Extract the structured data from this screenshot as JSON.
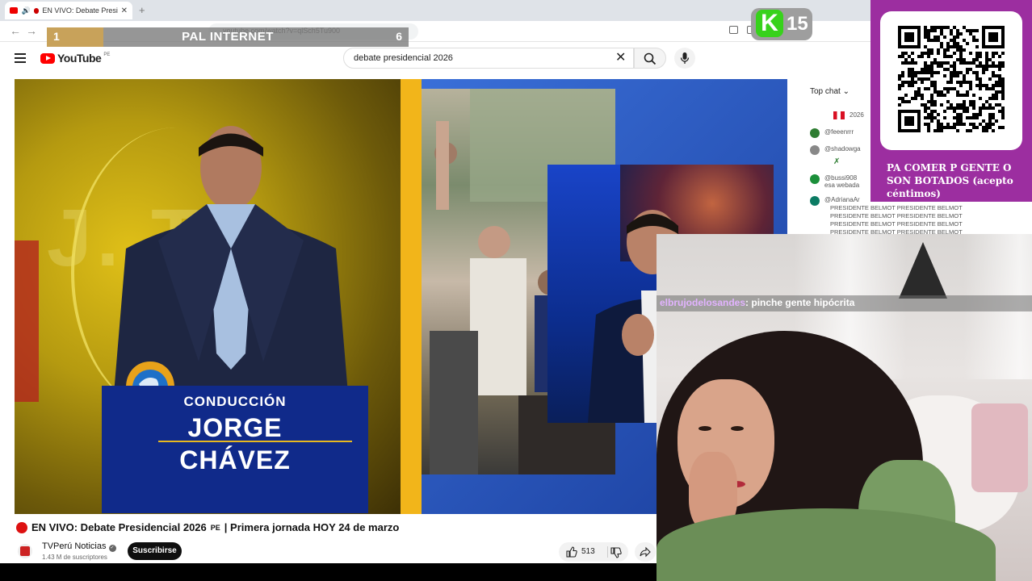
{
  "browser": {
    "tab_title": "EN VIVO: Debate Preside",
    "url": "youtube.com/watch?v=qlSch5Tu900"
  },
  "banner": {
    "left": "1",
    "center": "PAL INTERNET",
    "right": "6"
  },
  "logo_k15": {
    "letter": "K",
    "number": "15"
  },
  "youtube": {
    "logo": "YouTube",
    "country": "PE",
    "search_value": "debate presidencial 2026"
  },
  "video": {
    "lower_third_label": "CONDUCCIÓN",
    "lower_third_name1": "JORGE",
    "lower_third_name2": "CHÁVEZ",
    "bg_text": "J. T"
  },
  "details": {
    "title": "EN VIVO: Debate Presidencial 2026",
    "title_country": "PE",
    "title_rest": "| Primera jornada HOY 24 de marzo",
    "channel": "TVPerú Noticias",
    "subscribers": "1.43 M de suscriptores",
    "subscribe": "Suscribirse",
    "likes": "513"
  },
  "chat": {
    "header": "Top chat",
    "pinned": "2026",
    "messages": [
      {
        "user": "@feeenrrr",
        "color": "#2e7d32"
      },
      {
        "user": "@shadowga",
        "color": "#888888"
      },
      {
        "user": "@bussi908",
        "text": "esa webada",
        "color": "#1b8f3a"
      },
      {
        "user": "@AdrianaAr",
        "color": "#0b7b63"
      }
    ],
    "spam_lines": [
      "PRESIDENTE BELMOT PRESIDENTE BELMOT",
      "PRESIDENTE BELMOT PRESIDENTE BELMOT",
      "PRESIDENTE BELMOT PRESIDENTE BELMOT",
      "PRESIDENTE BELMOT PRESIDENTE BELMOT"
    ]
  },
  "qr_panel": {
    "text": "PA COMER P GENTE O SON BOTADOS (acepto céntimos)"
  },
  "stream_chat": {
    "user": "elbrujodelosandes",
    "message": ": pinche gente hipócrita"
  }
}
